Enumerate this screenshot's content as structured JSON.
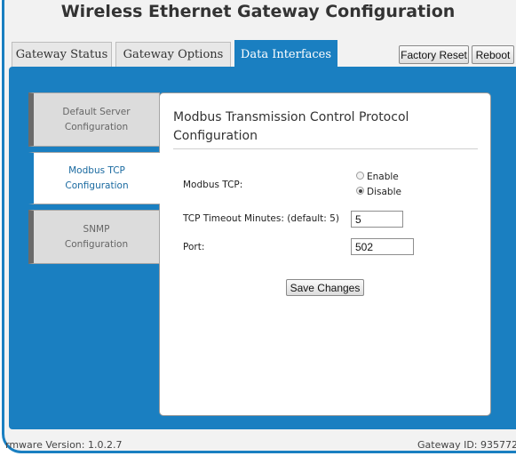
{
  "header": {
    "title": "Wireless Ethernet Gateway Configuration"
  },
  "tabs": [
    {
      "label": "Gateway Status",
      "active": false
    },
    {
      "label": "Gateway Options",
      "active": false
    },
    {
      "label": "Data Interfaces",
      "active": true
    }
  ],
  "toolbar": {
    "factory_reset_label": "Factory Reset",
    "reboot_label": "Reboot"
  },
  "sidebar": {
    "items": [
      {
        "label": "Default Server\nConfiguration",
        "active": false
      },
      {
        "label": "Modbus TCP\nConfiguration",
        "active": true
      },
      {
        "label": "SNMP\nConfiguration",
        "active": false
      }
    ]
  },
  "main": {
    "heading": "Modbus Transmission Control Protocol Configuration",
    "modbus_tcp": {
      "label": "Modbus TCP:",
      "options": [
        {
          "label": "Enable",
          "checked": false
        },
        {
          "label": "Disable",
          "checked": true
        }
      ]
    },
    "timeout": {
      "label": "TCP Timeout Minutes: (default: 5)",
      "value": "5"
    },
    "port": {
      "label": "Port:",
      "value": "502"
    },
    "save_label": "Save Changes"
  },
  "footer": {
    "firmware": "rmware Version: 1.0.2.7",
    "gateway_id": "Gateway ID: 935772"
  },
  "colors": {
    "accent": "#1a7fc1",
    "sidebar_bg": "#dcdcdc",
    "frame_bg": "#f2f2f2"
  }
}
